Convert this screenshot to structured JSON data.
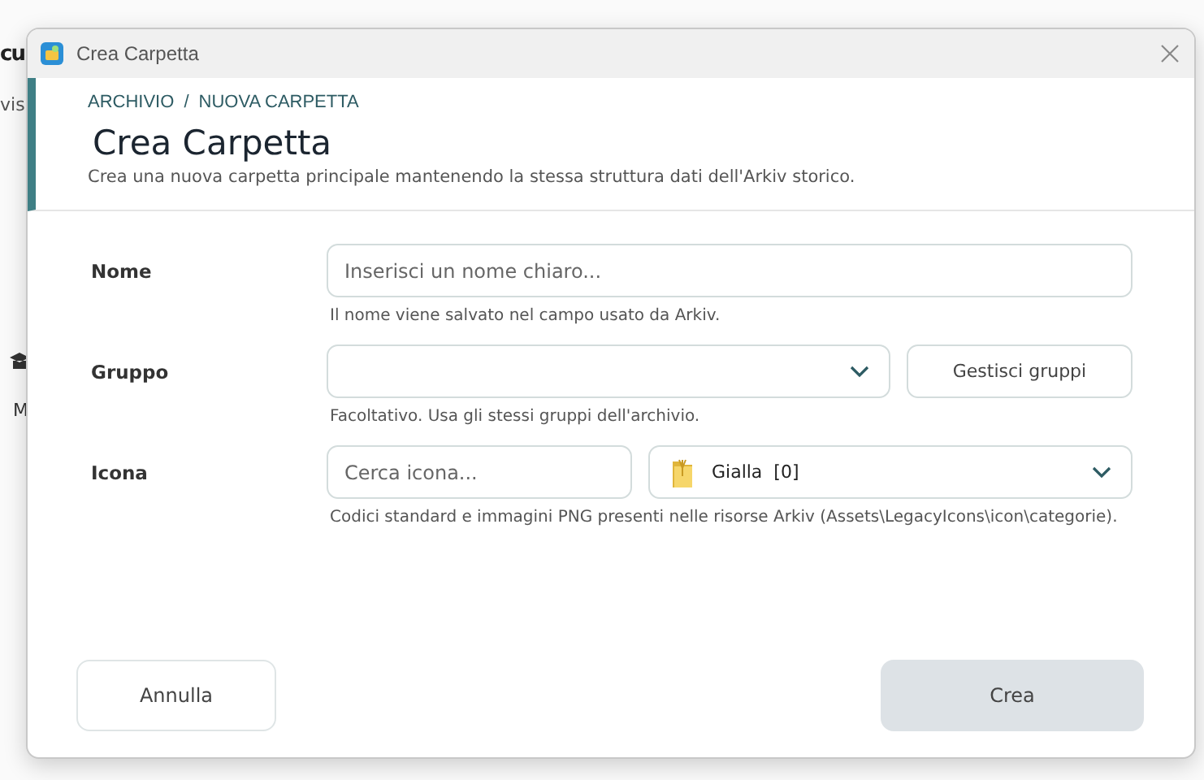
{
  "background": {
    "title_fragment": "cu",
    "subtitle_fragment": "vis",
    "item_fragment": "M"
  },
  "window": {
    "title": "Crea Carpetta"
  },
  "breadcrumb": {
    "items": [
      "ARCHIVIO",
      "NUOVA CARPETTA"
    ],
    "separator": "/"
  },
  "header": {
    "title": "Crea Carpetta",
    "subtitle": "Crea una nuova carpetta principale mantenendo la stessa struttura dati dell'Arkiv storico."
  },
  "fields": [
    {
      "kind": "text",
      "label": "Nome",
      "placeholder": "Inserisci un nome chiaro...",
      "hint": "Il nome viene salvato nel campo usato da Arkiv."
    },
    {
      "kind": "group",
      "label": "Gruppo",
      "button": "Gestisci gruppi",
      "hint": "Facoltativo. Usa gli stessi gruppi dell'archivio."
    },
    {
      "kind": "icon",
      "label": "Icona",
      "placeholder": "Cerca icona...",
      "value": "Gialla  [0]",
      "hint": "Codici standard e immagini PNG presenti nelle risorse Arkiv (Assets\\LegacyIcons\\icon\\categorie)."
    }
  ],
  "buttons": [
    {
      "label": "Annulla",
      "kind": "secondary",
      "disabled": false
    },
    {
      "label": "Crea",
      "kind": "primary",
      "disabled": true
    }
  ]
}
